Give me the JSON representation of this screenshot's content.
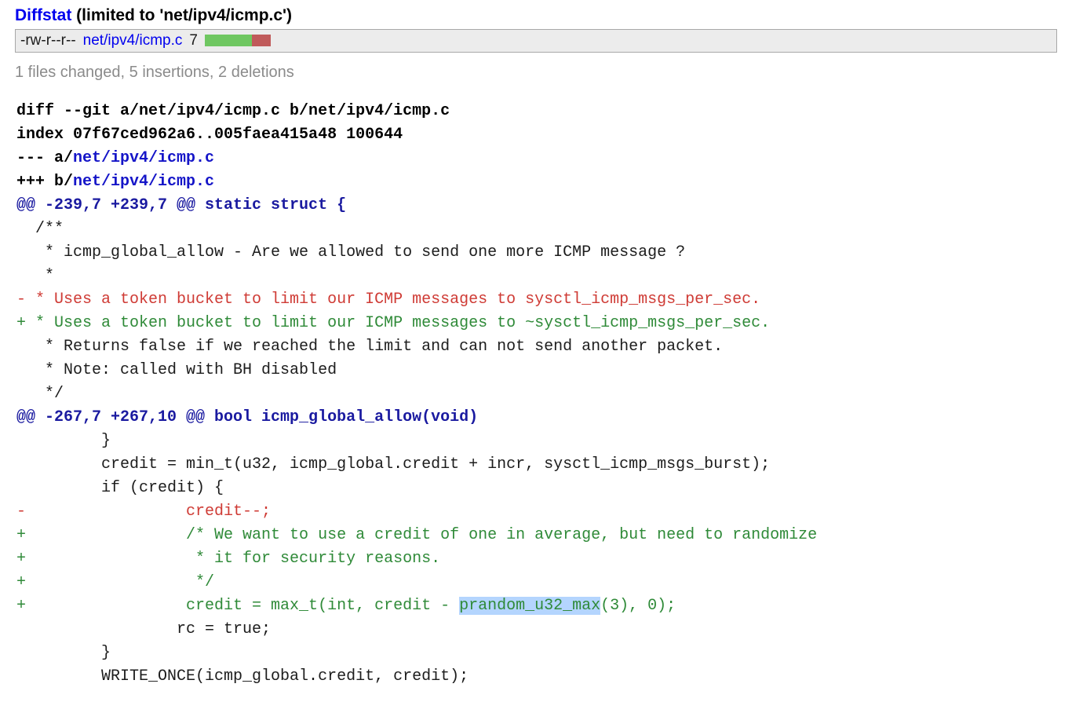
{
  "diffstat": {
    "heading_link": "Diffstat",
    "heading_rest": " (limited to 'net/ipv4/icmp.c')",
    "rows": [
      {
        "mode": "-rw-r--r--",
        "file": "net/ipv4/icmp.c",
        "count": "7",
        "additions": 5,
        "deletions": 2
      }
    ],
    "summary": "1 files changed, 5 insertions, 2 deletions",
    "colors": {
      "add_bar": "#6fc761",
      "del_bar": "#c05b5b",
      "link": "#0000ee",
      "box_bg": "#ececec",
      "box_border": "#a8a8a8",
      "summary_text": "#8b8b8b"
    }
  },
  "diff": {
    "colors": {
      "addition": "#2f8a38",
      "deletion": "#cf3b35",
      "hunk": "#1a1aa0",
      "header_link": "#1515c8",
      "context": "#1c1c1c",
      "selection": "#b4d5fe"
    },
    "lines": [
      {
        "kind": "header",
        "text": "diff --git a/net/ipv4/icmp.c b/net/ipv4/icmp.c"
      },
      {
        "kind": "header",
        "text": "index 07f67ced962a6..005faea415a48 100644"
      },
      {
        "kind": "header-link",
        "prefix": "--- a/",
        "link": "net/ipv4/icmp.c"
      },
      {
        "kind": "header-link",
        "prefix": "+++ b/",
        "link": "net/ipv4/icmp.c"
      },
      {
        "kind": "hunk",
        "text": "@@ -239,7 +239,7 @@ static struct {"
      },
      {
        "kind": "context",
        "text": "  /**"
      },
      {
        "kind": "context",
        "text": "   * icmp_global_allow - Are we allowed to send one more ICMP message ?"
      },
      {
        "kind": "context",
        "text": "   *"
      },
      {
        "kind": "del",
        "text": "- * Uses a token bucket to limit our ICMP messages to sysctl_icmp_msgs_per_sec."
      },
      {
        "kind": "add",
        "text": "+ * Uses a token bucket to limit our ICMP messages to ~sysctl_icmp_msgs_per_sec."
      },
      {
        "kind": "context",
        "text": "   * Returns false if we reached the limit and can not send another packet."
      },
      {
        "kind": "context",
        "text": "   * Note: called with BH disabled"
      },
      {
        "kind": "context",
        "text": "   */"
      },
      {
        "kind": "hunk",
        "text": "@@ -267,7 +267,10 @@ bool icmp_global_allow(void)"
      },
      {
        "kind": "context",
        "text": "         }"
      },
      {
        "kind": "context",
        "text": "         credit = min_t(u32, icmp_global.credit + incr, sysctl_icmp_msgs_burst);"
      },
      {
        "kind": "context",
        "text": "         if (credit) {"
      },
      {
        "kind": "del",
        "text": "-                 credit--;"
      },
      {
        "kind": "add",
        "text": "+                 /* We want to use a credit of one in average, but need to randomize"
      },
      {
        "kind": "add",
        "text": "+                  * it for security reasons."
      },
      {
        "kind": "add",
        "text": "+                  */"
      },
      {
        "kind": "add-selected",
        "before": "+                 credit = max_t(int, credit - ",
        "selected": "prandom_u32_max",
        "after": "(3), 0);"
      },
      {
        "kind": "context",
        "text": "                 rc = true;"
      },
      {
        "kind": "context",
        "text": "         }"
      },
      {
        "kind": "context",
        "text": "         WRITE_ONCE(icmp_global.credit, credit);"
      }
    ]
  }
}
